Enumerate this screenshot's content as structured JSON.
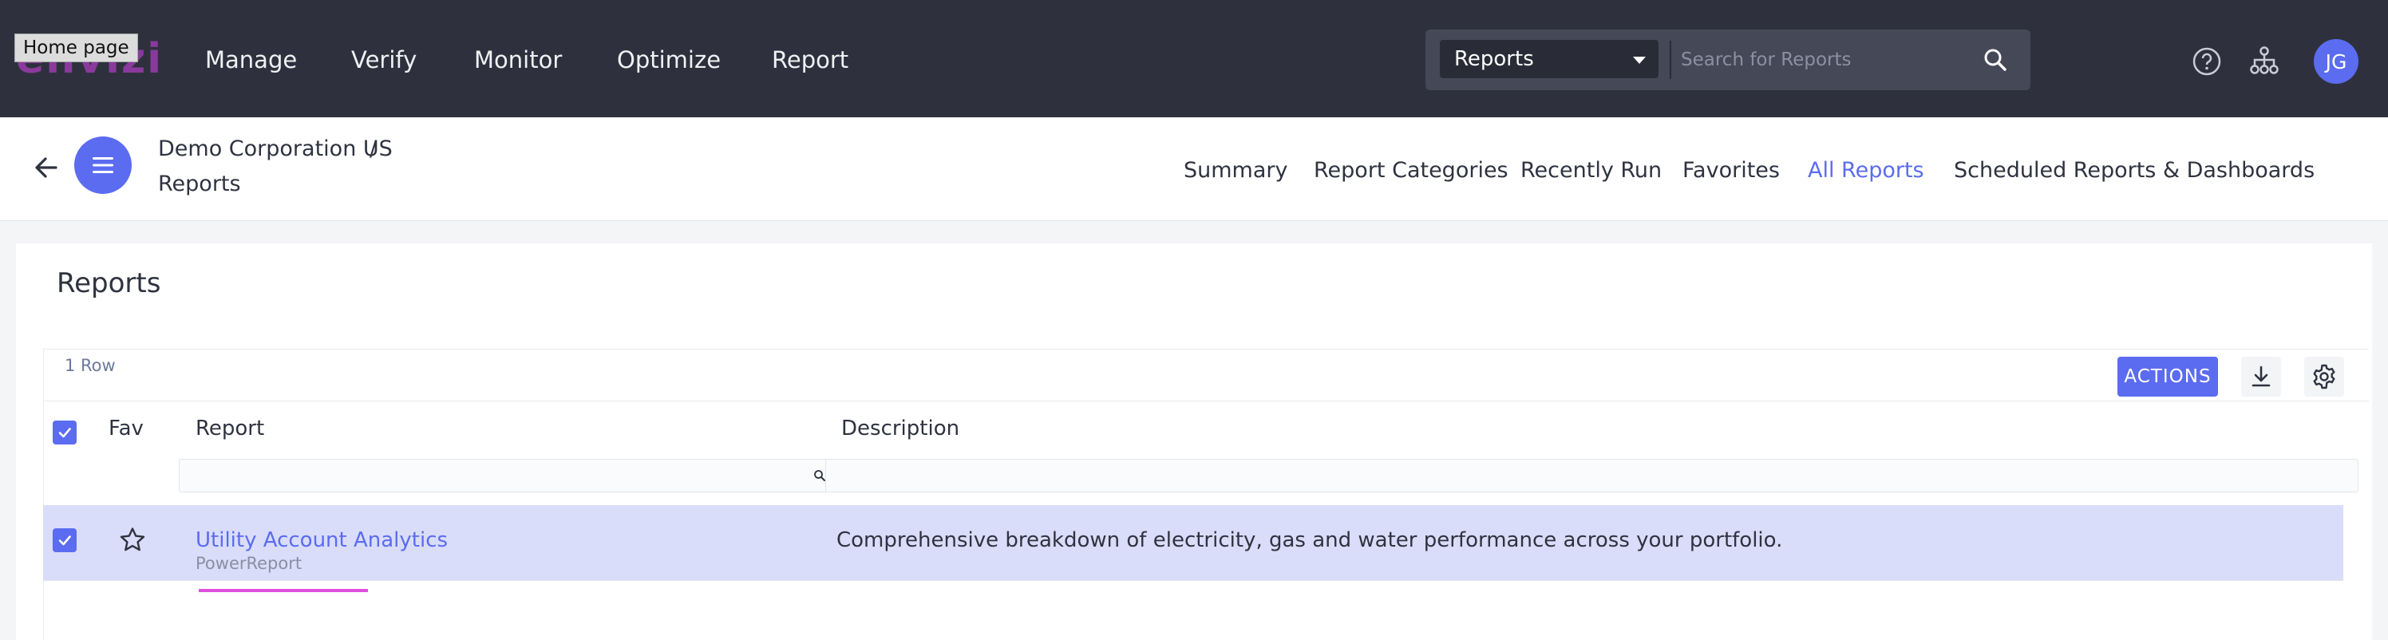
{
  "app": {
    "logo_text": "envizi",
    "tooltip": "Home page"
  },
  "topnav": {
    "items": [
      {
        "label": "Manage"
      },
      {
        "label": "Verify"
      },
      {
        "label": "Monitor"
      },
      {
        "label": "Optimize"
      },
      {
        "label": "Report"
      }
    ],
    "search": {
      "scope": "Reports",
      "placeholder": "Search for Reports"
    },
    "icons": [
      "help-icon",
      "org-hierarchy-icon"
    ],
    "avatar_initials": "JG"
  },
  "breadcrumb": {
    "org": "Demo Corporation US",
    "separator": "/",
    "page": "Reports"
  },
  "tabs": [
    {
      "label": "Summary",
      "active": false
    },
    {
      "label": "Report Categories",
      "active": false
    },
    {
      "label": "Recently Run",
      "active": false
    },
    {
      "label": "Favorites",
      "active": false
    },
    {
      "label": "All Reports",
      "active": true
    },
    {
      "label": "Scheduled Reports & Dashboards",
      "active": false
    }
  ],
  "panel": {
    "title": "Reports",
    "row_count": "1 Row",
    "actions_label": "ACTIONS",
    "columns": {
      "fav": "Fav",
      "report": "Report",
      "description": "Description"
    },
    "rows": [
      {
        "selected": true,
        "favorite": false,
        "report": "Utility Account Analytics",
        "type": "PowerReport",
        "description": "Comprehensive breakdown of electricity, gas and water performance across your portfolio."
      }
    ]
  },
  "colors": {
    "topbar": "#2e313d",
    "accent": "#5b6cf0",
    "selected_row": "#d9ddf9"
  }
}
